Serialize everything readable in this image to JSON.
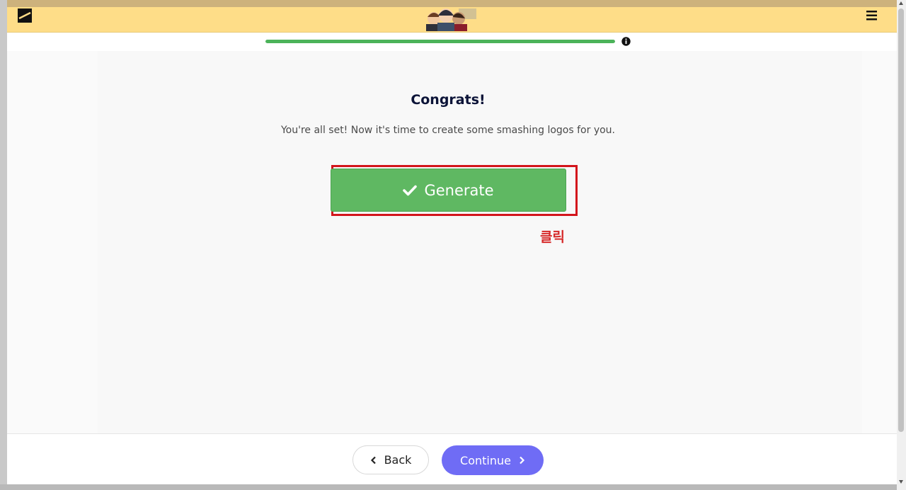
{
  "header": {
    "logo_icon": "brand-logo-icon",
    "menu_icon": "hamburger-menu-icon",
    "avatar_image": "team-avatars"
  },
  "progress": {
    "value_fraction": 1.0,
    "info_icon": "info-icon",
    "fill_color": "#4cb35a"
  },
  "main": {
    "title": "Congrats!",
    "subtitle": "You're all set! Now it's time to create some smashing logos for you.",
    "generate_label": "Generate",
    "generate_icon": "check-icon",
    "generate_color": "#5fb862"
  },
  "annotation": {
    "text": "클릭",
    "color": "#d62a2a"
  },
  "footer": {
    "back_label": "Back",
    "continue_label": "Continue",
    "continue_color": "#6f6cf5"
  }
}
